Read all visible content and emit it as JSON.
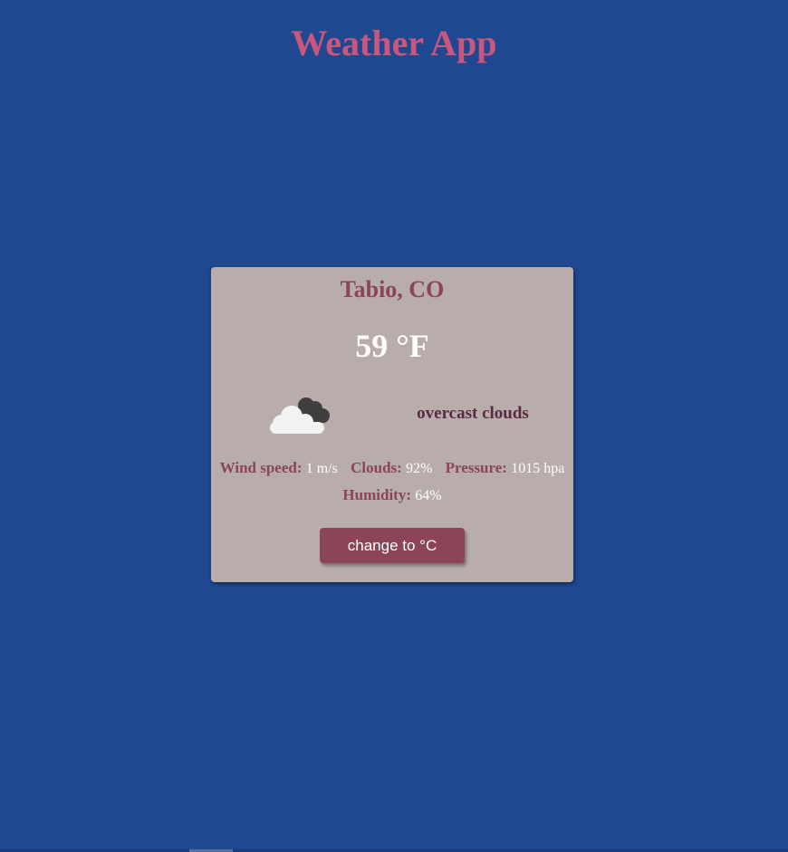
{
  "app": {
    "title": "Weather App"
  },
  "weather": {
    "location": "Tabio, CO",
    "temperature": "59 °F",
    "icon": "overcast-clouds-icon",
    "description": "overcast clouds",
    "stats": {
      "wind_speed_label": "Wind speed:",
      "wind_speed_value": "1 m/s",
      "clouds_label": "Clouds:",
      "clouds_value": "92%",
      "pressure_label": "Pressure:",
      "pressure_value": "1015 hpa",
      "humidity_label": "Humidity:",
      "humidity_value": "64%"
    },
    "toggle_button_label": "change to °C"
  },
  "colors": {
    "background": "#1f4891",
    "title": "#c9577c",
    "card": "#b8adab",
    "accent": "#8b4557",
    "description": "#5a2a42",
    "text_light": "#ffffff"
  }
}
